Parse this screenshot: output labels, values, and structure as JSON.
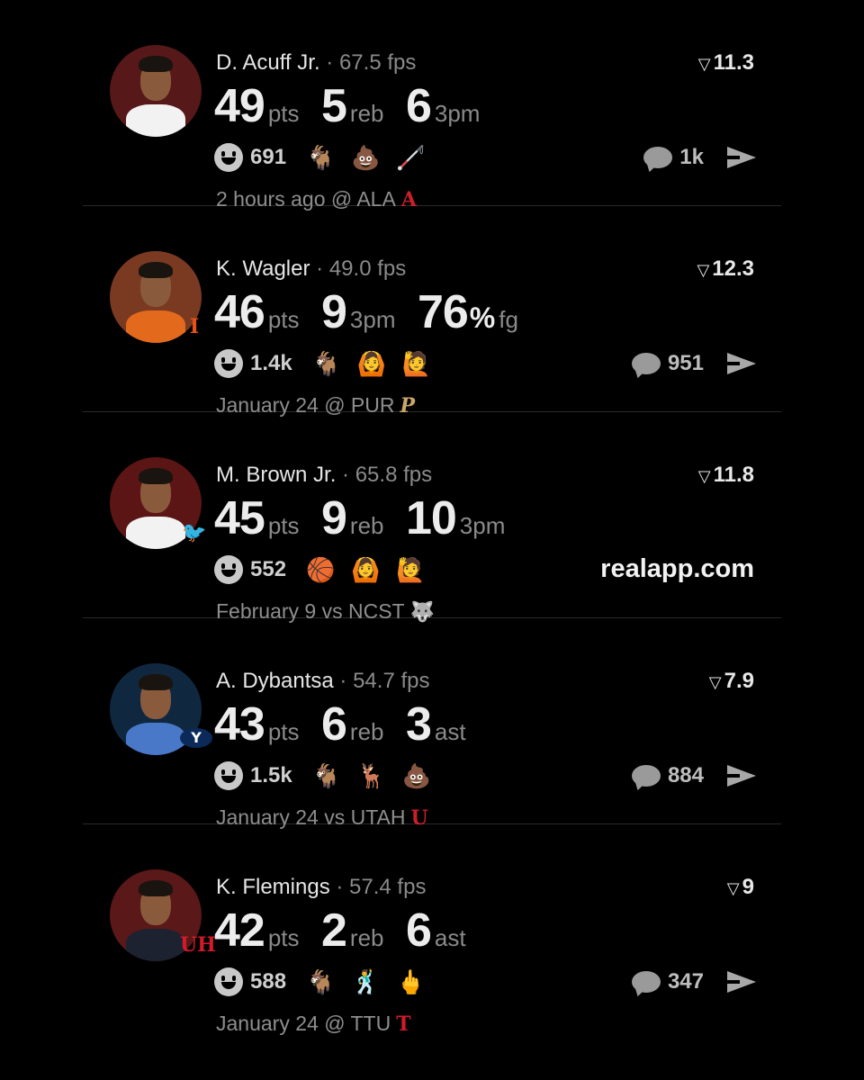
{
  "feed": [
    {
      "player": "D. Acuff Jr.",
      "separator": "·",
      "fps": "67.5 fps",
      "score": "11.3",
      "team_logo": "",
      "stats": [
        {
          "num": "49",
          "unit": "pts"
        },
        {
          "num": "5",
          "unit": "reb"
        },
        {
          "num": "6",
          "unit": "3pm"
        }
      ],
      "reaction_count": "691",
      "reactions": [
        "🐐",
        "💩",
        "🦯"
      ],
      "comments": "1k",
      "game": "2 hours ago @ ALA",
      "opp_logo": "A"
    },
    {
      "player": "K. Wagler",
      "separator": "·",
      "fps": "49.0 fps",
      "score": "12.3",
      "team_logo": "I",
      "stats": [
        {
          "num": "46",
          "unit": "pts"
        },
        {
          "num": "9",
          "unit": "3pm"
        },
        {
          "num": "76",
          "pct": "%",
          "unit": "fg"
        }
      ],
      "reaction_count": "1.4k",
      "reactions": [
        "🐐",
        "🙆",
        "🙋"
      ],
      "comments": "951",
      "game": "January 24 @ PUR",
      "opp_logo": "P"
    },
    {
      "player": "M. Brown Jr.",
      "separator": "·",
      "fps": "65.8 fps",
      "score": "11.8",
      "team_logo": "🐦",
      "stats": [
        {
          "num": "45",
          "unit": "pts"
        },
        {
          "num": "9",
          "unit": "reb"
        },
        {
          "num": "10",
          "unit": "3pm"
        }
      ],
      "reaction_count": "552",
      "reactions": [
        "🏀",
        "🙆",
        "🙋"
      ],
      "promo": "realapp.com",
      "game": "February 9 vs NCST",
      "opp_logo": "🐺"
    },
    {
      "player": "A. Dybantsa",
      "separator": "·",
      "fps": "54.7 fps",
      "score": "7.9",
      "team_logo": "Y",
      "stats": [
        {
          "num": "43",
          "unit": "pts"
        },
        {
          "num": "6",
          "unit": "reb"
        },
        {
          "num": "3",
          "unit": "ast"
        }
      ],
      "reaction_count": "1.5k",
      "reactions": [
        "🐐",
        "🦌",
        "💩"
      ],
      "comments": "884",
      "game": "January 24 vs UTAH",
      "opp_logo": "U"
    },
    {
      "player": "K. Flemings",
      "separator": "·",
      "fps": "57.4 fps",
      "score": "9",
      "team_logo": "UH",
      "stats": [
        {
          "num": "42",
          "unit": "pts"
        },
        {
          "num": "2",
          "unit": "reb"
        },
        {
          "num": "6",
          "unit": "ast"
        }
      ],
      "reaction_count": "588",
      "reactions": [
        "🐐",
        "🕺",
        "🖕"
      ],
      "comments": "347",
      "game": "January 24 @ TTU",
      "opp_logo": "T"
    }
  ],
  "icons": {
    "score": "trend-icon",
    "react": "smiley-icon",
    "comment": "comment-bubble-icon",
    "share": "send-icon"
  }
}
